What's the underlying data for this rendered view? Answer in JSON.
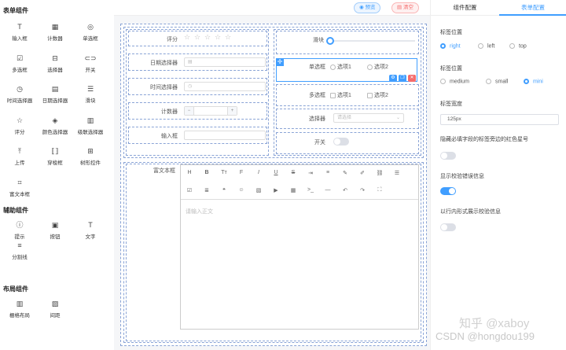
{
  "left": {
    "form_section": "表单组件",
    "form_items": [
      {
        "label": "输入框",
        "icon": "input-icon",
        "glyph": "T"
      },
      {
        "label": "计数器",
        "icon": "counter-icon",
        "glyph": "▦"
      },
      {
        "label": "单选框",
        "icon": "radio-icon",
        "glyph": "◎"
      },
      {
        "label": "多选框",
        "icon": "checkbox-icon",
        "glyph": "☑"
      },
      {
        "label": "选择器",
        "icon": "select-icon",
        "glyph": "⊟"
      },
      {
        "label": "开关",
        "icon": "switch-icon",
        "glyph": "⊂⊃"
      },
      {
        "label": "时间选择器",
        "icon": "clock-icon",
        "glyph": "◷"
      },
      {
        "label": "日期选择器",
        "icon": "calendar-icon",
        "glyph": "▤"
      },
      {
        "label": "滑块",
        "icon": "slider-icon",
        "glyph": "☰"
      },
      {
        "label": "评分",
        "icon": "star-icon",
        "glyph": "☆"
      },
      {
        "label": "颜色选择器",
        "icon": "palette-icon",
        "glyph": "◈"
      },
      {
        "label": "级联选择器",
        "icon": "cascader-icon",
        "glyph": "▥"
      },
      {
        "label": "上传",
        "icon": "upload-icon",
        "glyph": "⤒"
      },
      {
        "label": "穿梭框",
        "icon": "transfer-icon",
        "glyph": "⟦⟧"
      },
      {
        "label": "树形控件",
        "icon": "tree-icon",
        "glyph": "⊞"
      },
      {
        "label": "富文本框",
        "icon": "editor-icon",
        "glyph": "⌗"
      }
    ],
    "assist_section": "辅助组件",
    "assist_items": [
      {
        "label": "提示",
        "icon": "info-icon",
        "glyph": "ⓘ"
      },
      {
        "label": "按钮",
        "icon": "button-icon",
        "glyph": "▣"
      },
      {
        "label": "文字",
        "icon": "text-icon",
        "glyph": "T"
      },
      {
        "label": "分割线",
        "icon": "divider-icon",
        "glyph": "≡"
      }
    ],
    "layout_section": "布局组件",
    "layout_items": [
      {
        "label": "栅格布局",
        "icon": "grid-icon",
        "glyph": "▥"
      },
      {
        "label": "间距",
        "icon": "spacing-icon",
        "glyph": "▨"
      }
    ]
  },
  "toolbar": {
    "preview": "预览",
    "clear": "清空"
  },
  "form": {
    "rate_label": "评分",
    "date_label": "日期选择器",
    "time_label": "时间选择器",
    "counter_label": "计数器",
    "counter_minus": "−",
    "counter_plus": "+",
    "input_label": "输入框",
    "slider_label": "滑块",
    "radio_label": "单选框",
    "radio_opt1": "选项1",
    "radio_opt2": "选项2",
    "checkbox_label": "多选框",
    "checkbox_opt1": "选项1",
    "checkbox_opt2": "选项2",
    "select_label": "选择器",
    "select_placeholder": "请选择",
    "switch_label": "开关",
    "richtext_label": "富文本框",
    "richtext_placeholder": "请输入正文"
  },
  "right": {
    "tab_component": "组件配置",
    "tab_form": "表单配置",
    "label_pos_title": "标签位置",
    "label_pos_options": [
      "right",
      "left",
      "top"
    ],
    "label_pos_selected": "right",
    "label_size_title": "标签位置",
    "label_size_options": [
      "medium",
      "small",
      "mini"
    ],
    "label_size_selected": "mini",
    "label_width_title": "标签宽度",
    "label_width_value": "125px",
    "hide_required_title": "隐藏必填字段的标签旁边的红色星号",
    "hide_required_on": false,
    "show_error_title": "显示校验错误信息",
    "show_error_on": true,
    "inline_error_title": "以行内形式展示校验信息",
    "inline_error_on": false
  },
  "watermark": {
    "line1": "知乎 @xaboy",
    "line2": "CSDN @hongdou199"
  },
  "colors": {
    "accent": "#409eff",
    "danger": "#f56c6c",
    "dashed": "#8aa4d6"
  }
}
